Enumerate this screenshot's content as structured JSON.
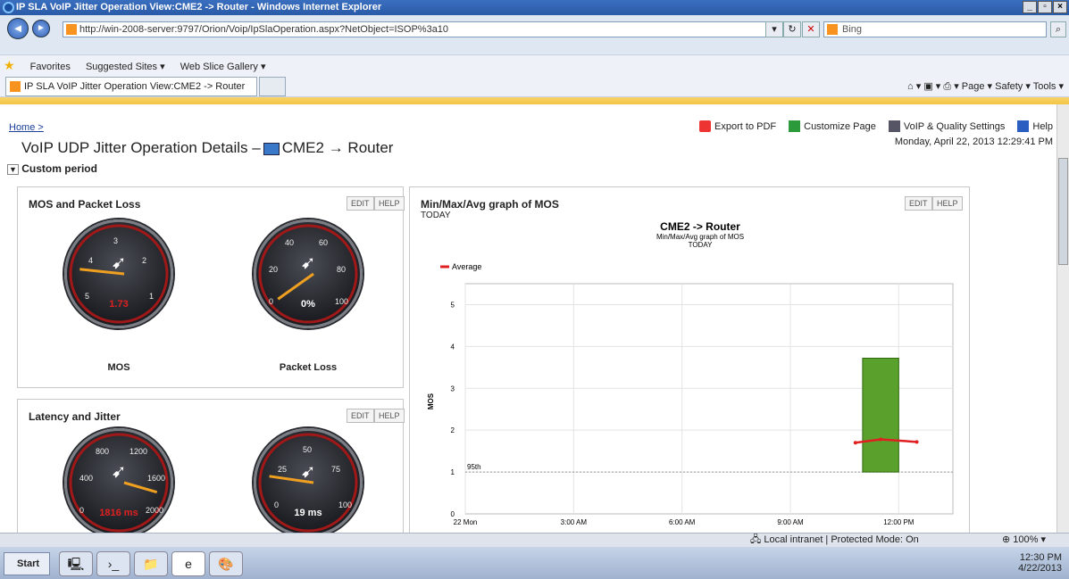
{
  "window": {
    "title": "IP SLA VoIP Jitter Operation View:CME2 -> Router - Windows Internet Explorer"
  },
  "browser": {
    "address": "http://win-2008-server:9797/Orion/Voip/IpSlaOperation.aspx?NetObject=ISOP%3a10",
    "search_placeholder": "Bing",
    "favorites": [
      "Favorites",
      "Suggested Sites ▾",
      "Web Slice Gallery ▾"
    ],
    "tab_title": "IP SLA VoIP Jitter Operation View:CME2 -> Router",
    "command_bar": "Page ▾   Safety ▾   Tools ▾"
  },
  "page": {
    "breadcrumb": "Home >",
    "title_prefix": "VoIP UDP Jitter Operation Details –",
    "title_node": "CME2 → Router",
    "custom_period": "Custom period",
    "links": {
      "export": "Export to PDF",
      "customize": "Customize Page",
      "settings": "VoIP & Quality Settings",
      "help": "Help"
    },
    "datetime": "Monday, April 22, 2013 12:29:41 PM",
    "buttons": {
      "edit": "EDIT",
      "help": "HELP"
    }
  },
  "panels": {
    "mos_packet": {
      "title": "MOS and Packet Loss",
      "gauges": [
        {
          "label": "MOS",
          "value": "1.73",
          "ticks": [
            "3",
            "4",
            "2",
            "5",
            "1"
          ],
          "value_color": "#e02020",
          "needle_fraction": 0.18
        },
        {
          "label": "Packet Loss",
          "value": "0%",
          "ticks": [
            "40",
            "60",
            "20",
            "80",
            "0",
            "100"
          ],
          "value_color": "#ffffff",
          "needle_fraction": 0.0
        }
      ]
    },
    "latency_jitter": {
      "title": "Latency and Jitter",
      "gauges": [
        {
          "value": "1816 ms",
          "ticks": [
            "800",
            "1200",
            "400",
            "1600",
            "0",
            "2000"
          ],
          "value_color": "#e02020",
          "needle_fraction": 0.9
        },
        {
          "value": "19 ms",
          "ticks": [
            "50",
            "25",
            "75",
            "0",
            "100"
          ],
          "value_color": "#ffffff",
          "needle_fraction": 0.19
        }
      ]
    },
    "chart_panel": {
      "title": "Min/Max/Avg graph of MOS",
      "subtitle": "TODAY"
    }
  },
  "chart_data": {
    "type": "bar",
    "title": "CME2 -> Router",
    "subtitle": "Min/Max/Avg graph of MOS",
    "subtitle2": "TODAY",
    "legend": [
      "Average"
    ],
    "ylabel": "MOS",
    "ylim": [
      0,
      5.5
    ],
    "yticks": [
      0,
      1,
      2,
      3,
      4,
      5
    ],
    "xticks": [
      "22 Mon",
      "3:00 AM",
      "6:00 AM",
      "9:00 AM",
      "12:00 PM"
    ],
    "xlim_hours": [
      0,
      13.5
    ],
    "reference_line": {
      "label": "95th",
      "value": 1.0
    },
    "bar": {
      "hour_start": 11.0,
      "hour_end": 12.0,
      "min": 1.0,
      "max": 3.72
    },
    "average": {
      "hours": [
        10.8,
        11.5,
        12.5
      ],
      "values": [
        1.7,
        1.78,
        1.72
      ]
    },
    "colors": {
      "bar": "#5aa02c",
      "average": "#e02020"
    }
  },
  "status": {
    "zone": "Local intranet | Protected Mode: On",
    "zoom": "100%"
  },
  "taskbar": {
    "start": "Start",
    "time": "12:30 PM",
    "date": "4/22/2013"
  }
}
